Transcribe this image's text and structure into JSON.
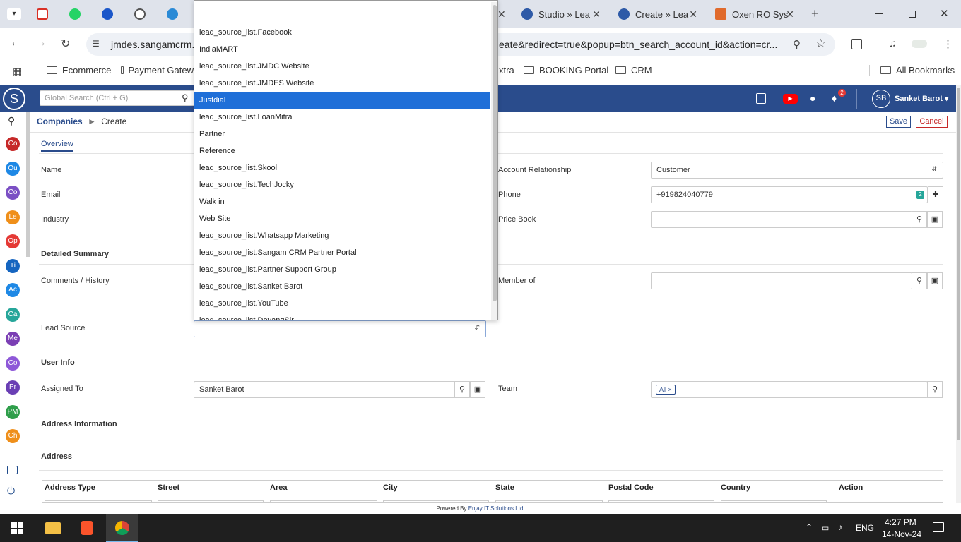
{
  "browser": {
    "tabs": [
      {
        "title": "Studio » Lea",
        "color": "#2e5aa7"
      },
      {
        "title": "Create » Lea",
        "color": "#2e5aa7"
      },
      {
        "title": "Oxen RO Sys",
        "color": "#e06a2c"
      }
    ],
    "url_left": "jmdes.sangamcrm.c",
    "url_right": "eate&redirect=true&popup=btn_search_account_id&action=cr...",
    "new_tab": "+",
    "bookmarks": [
      "Ecommerce",
      "Payment Gatew",
      "xtra",
      "BOOKING Portal",
      "CRM"
    ],
    "all_bookmarks": "All Bookmarks"
  },
  "header": {
    "logo": "S",
    "search_placeholder": "Global Search (Ctrl + G)",
    "notif_count": "2",
    "avatar": "SB",
    "user_name": "Sanket Barot ▾",
    "yt": "▶"
  },
  "sidebar": {
    "items": [
      {
        "label": "Co",
        "color": "#c62828"
      },
      {
        "label": "Qu",
        "color": "#1e88e5"
      },
      {
        "label": "Co",
        "color": "#7b4fc4"
      },
      {
        "label": "Le",
        "color": "#ef8f1a"
      },
      {
        "label": "Op",
        "color": "#e53935"
      },
      {
        "label": "Ti",
        "color": "#1565c0"
      },
      {
        "label": "Ac",
        "color": "#1e88e5"
      },
      {
        "label": "Ca",
        "color": "#26a69a"
      },
      {
        "label": "Me",
        "color": "#7b3fb4"
      },
      {
        "label": "Co",
        "color": "#8e58d8"
      },
      {
        "label": "Pr",
        "color": "#6a3fb4"
      },
      {
        "label": "PM",
        "color": "#2e9e4a"
      },
      {
        "label": "Ch",
        "color": "#ef8f1a"
      }
    ]
  },
  "breadcrumb": {
    "root": "Companies",
    "sep": "►",
    "current": "Create"
  },
  "actions": {
    "save": "Save",
    "cancel": "Cancel"
  },
  "tab_overview": "Overview",
  "form": {
    "name_label": "Name",
    "email_label": "Email",
    "industry_label": "Industry",
    "detailed_summary": "Detailed Summary",
    "comments_label": "Comments / History",
    "lead_source_label": "Lead Source",
    "user_info": "User Info",
    "assigned_to_label": "Assigned To",
    "assigned_to_value": "Sanket Barot",
    "team_label": "Team",
    "team_tag": "All",
    "address_information": "Address Information",
    "address_label": "Address",
    "account_relationship_label": "Account Relationship",
    "account_relationship_value": "Customer",
    "phone_label": "Phone",
    "phone_value": "+919824040779",
    "phone_badge": "2",
    "price_book_label": "Price Book",
    "member_of_label": "Member of"
  },
  "address_table": {
    "columns": [
      "Address Type",
      "Street",
      "Area",
      "City",
      "State",
      "Postal Code",
      "Country",
      "Action"
    ]
  },
  "lead_source_options": [
    "",
    "lead_source_list.Facebook",
    "IndiaMART",
    "lead_source_list.JMDC Website",
    "lead_source_list.JMDES Website",
    "Justdial",
    "lead_source_list.LoanMitra",
    "Partner",
    "Reference",
    "lead_source_list.Skool",
    "lead_source_list.TechJocky",
    "Walk in",
    "Web Site",
    "lead_source_list.Whatsapp Marketing",
    "lead_source_list.Sangam CRM Partner Portal",
    "lead_source_list.Partner Support Group",
    "lead_source_list.Sanket Barot",
    "lead_source_list.YouTube",
    "lead_source_list.DevangSir"
  ],
  "selected_option": "Justdial",
  "footer": {
    "prefix": "Powered By ",
    "company": "Enjay IT Solutions Ltd."
  },
  "taskbar": {
    "lang": "ENG",
    "time": "4:27 PM",
    "date": "14-Nov-24"
  }
}
